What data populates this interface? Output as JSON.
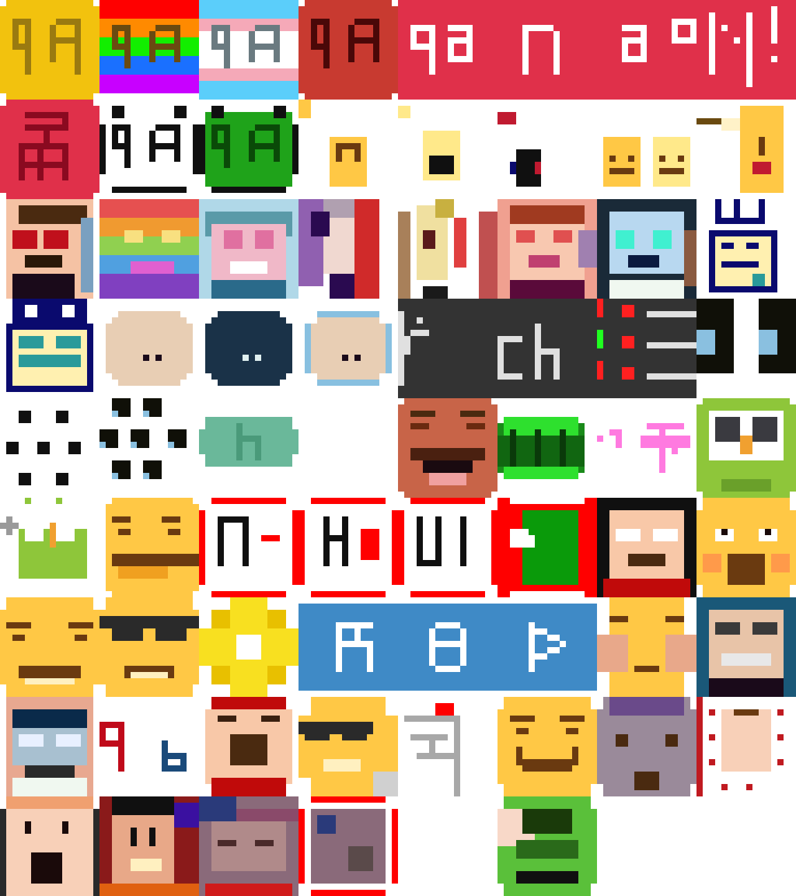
{
  "title": "",
  "colors": {
    "red": "#e0304a",
    "yellow": "#ffc845",
    "blue": "#3f8ac6",
    "navy": "#0a0a6e",
    "green": "#22a71c",
    "black": "#101010",
    "skin": "#e8ceb4",
    "white": "#ffffff"
  },
  "tiles": [
    {
      "name": "emote-gradient-gold",
      "icon": "ga-gold-circle-icon"
    },
    {
      "name": "emote-gradient-rainbow",
      "icon": "ga-rainbow-icon"
    },
    {
      "name": "emote-gradient-trans",
      "icon": "ga-trans-flag-icon"
    },
    {
      "name": "emote-gradient-darkred",
      "icon": "ga-darkred-circle-icon"
    },
    {
      "name": "emote-banner-red",
      "icon": "red-banner-icon"
    },
    {
      "name": "emote-red-symbol",
      "icon": "red-symbol-icon"
    },
    {
      "name": "emote-panda",
      "icon": "panda-ga-icon"
    },
    {
      "name": "emote-green-ga",
      "icon": "green-ga-icon"
    },
    {
      "name": "emote-face-row",
      "icon": "yellow-faces-icon"
    },
    {
      "name": "emote-key-face",
      "icon": "key-face-icon"
    },
    {
      "name": "emote-portrait-1",
      "icon": "portrait-icon"
    },
    {
      "name": "emote-rainbow-face",
      "icon": "rainbow-face-icon"
    },
    {
      "name": "emote-pink-face",
      "icon": "pink-face-icon"
    },
    {
      "name": "emote-purple-face",
      "icon": "purple-face-icon"
    },
    {
      "name": "emote-mixed-face",
      "icon": "mixed-face-icon"
    },
    {
      "name": "emote-peach-face",
      "icon": "peach-face-icon"
    },
    {
      "name": "emote-dark-face",
      "icon": "dark-face-icon"
    },
    {
      "name": "emote-navy-ghost",
      "icon": "navy-ghost-icon"
    },
    {
      "name": "emote-navy-ghost-2",
      "icon": "navy-ghost-glasses-icon"
    },
    {
      "name": "emote-beige-blob",
      "icon": "beige-blob-icon"
    },
    {
      "name": "emote-navy-blob",
      "icon": "navy-blob-icon"
    },
    {
      "name": "emote-beige-blob-blue",
      "icon": "beige-blob-blue-icon"
    },
    {
      "name": "emote-chat-banner",
      "icon": "chat-banner-icon"
    },
    {
      "name": "emote-eyes",
      "icon": "eyes-icon"
    },
    {
      "name": "emote-dots",
      "icon": "dots-icon"
    },
    {
      "name": "emote-blue-dots",
      "icon": "blue-dots-icon"
    },
    {
      "name": "emote-teal-blob",
      "icon": "teal-blob-icon"
    },
    {
      "name": "emote-blank",
      "icon": "blank-icon"
    },
    {
      "name": "emote-mustache",
      "icon": "mustache-face-icon"
    },
    {
      "name": "emote-green-bar",
      "icon": "green-bar-icon"
    },
    {
      "name": "emote-pink-sign",
      "icon": "pink-sign-icon"
    },
    {
      "name": "emote-owl",
      "icon": "owl-icon"
    },
    {
      "name": "emote-owl-small",
      "icon": "owl-small-icon"
    },
    {
      "name": "emote-smirk",
      "icon": "smirk-face-icon"
    },
    {
      "name": "emote-red-banner-1",
      "icon": "red-outline-icon"
    },
    {
      "name": "emote-red-banner-2",
      "icon": "red-outline-icon"
    },
    {
      "name": "emote-red-banner-3",
      "icon": "red-outline-icon"
    },
    {
      "name": "emote-red-green",
      "icon": "red-green-icon"
    },
    {
      "name": "emote-hair-face",
      "icon": "hair-face-icon"
    },
    {
      "name": "emote-shocked",
      "icon": "shocked-face-icon"
    },
    {
      "name": "emote-angry",
      "icon": "angry-face-icon"
    },
    {
      "name": "emote-sunglasses",
      "icon": "sunglasses-face-icon"
    },
    {
      "name": "emote-sparkle",
      "icon": "sparkle-icon"
    },
    {
      "name": "emote-blue-banner",
      "icon": "blue-banner-icon"
    },
    {
      "name": "emote-shrug",
      "icon": "shrug-face-icon"
    },
    {
      "name": "emote-glasses-man",
      "icon": "glasses-man-icon"
    },
    {
      "name": "emote-glasses-man-2",
      "icon": "glasses-man-2-icon"
    },
    {
      "name": "emote-ga-letters",
      "icon": "ga-letters-icon"
    },
    {
      "name": "emote-yelling",
      "icon": "yelling-face-icon"
    },
    {
      "name": "emote-cool",
      "icon": "cool-face-icon"
    },
    {
      "name": "emote-grey-symbol",
      "icon": "grey-symbol-icon"
    },
    {
      "name": "emote-grin",
      "icon": "grin-face-icon"
    },
    {
      "name": "emote-grey-face",
      "icon": "grey-face-icon"
    },
    {
      "name": "emote-checkered",
      "icon": "checkered-face-icon"
    },
    {
      "name": "emote-screaming",
      "icon": "screaming-man-icon"
    },
    {
      "name": "emote-dark-man",
      "icon": "dark-man-icon"
    },
    {
      "name": "emote-purple-hair",
      "icon": "purple-hair-icon"
    },
    {
      "name": "emote-red-ring",
      "icon": "red-ring-icon"
    },
    {
      "name": "emote-green-pepe",
      "icon": "green-frog-icon"
    }
  ]
}
